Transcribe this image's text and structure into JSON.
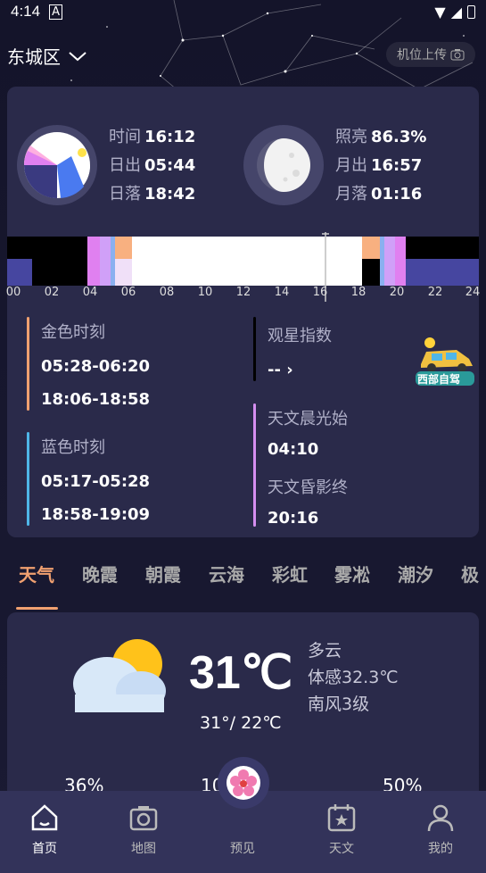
{
  "status_bar": {
    "time": "4:14"
  },
  "location": {
    "name": "东城区",
    "upload_label": "机位上传"
  },
  "sun": {
    "time_label": "时间",
    "time_value": "16:12",
    "rise_label": "日出",
    "rise_value": "05:44",
    "set_label": "日落",
    "set_value": "18:42"
  },
  "moon": {
    "illum_label": "照亮",
    "illum_value": "86.3%",
    "rise_label": "月出",
    "rise_value": "16:57",
    "set_label": "月落",
    "set_value": "01:16"
  },
  "timeline_ticks": [
    "00",
    "02",
    "04",
    "06",
    "08",
    "10",
    "12",
    "14",
    "16",
    "18",
    "20",
    "22",
    "24"
  ],
  "golden_hour": {
    "title": "金色时刻",
    "morning": "05:28-06:20",
    "evening": "18:06-18:58"
  },
  "blue_hour": {
    "title": "蓝色时刻",
    "morning": "05:17-05:28",
    "evening": "18:58-19:09"
  },
  "stargazing": {
    "title": "观星指数",
    "value": "-- ›",
    "badge": "西部自驾"
  },
  "astro": {
    "dawn_title": "天文晨光始",
    "dawn_value": "04:10",
    "dusk_title": "天文昏影终",
    "dusk_value": "20:16"
  },
  "tabs": [
    "天气",
    "晚霞",
    "朝霞",
    "云海",
    "彩虹",
    "雾凇",
    "潮汐",
    "极"
  ],
  "weather": {
    "temp": "31℃",
    "range": "31°/ 22℃",
    "cond": "多云",
    "feels": "体感32.3℃",
    "wind": "南风3级",
    "humidity": "36%",
    "pressure": "10  Pa",
    "other": "50%"
  },
  "nav": {
    "home": "首页",
    "map": "地图",
    "preview": "预见",
    "astro": "天文",
    "mine": "我的"
  },
  "colors": {
    "accent": "#f0a070",
    "golden": "#f0a070",
    "blue": "#4fb6e8",
    "astro": "#d58ef0"
  }
}
